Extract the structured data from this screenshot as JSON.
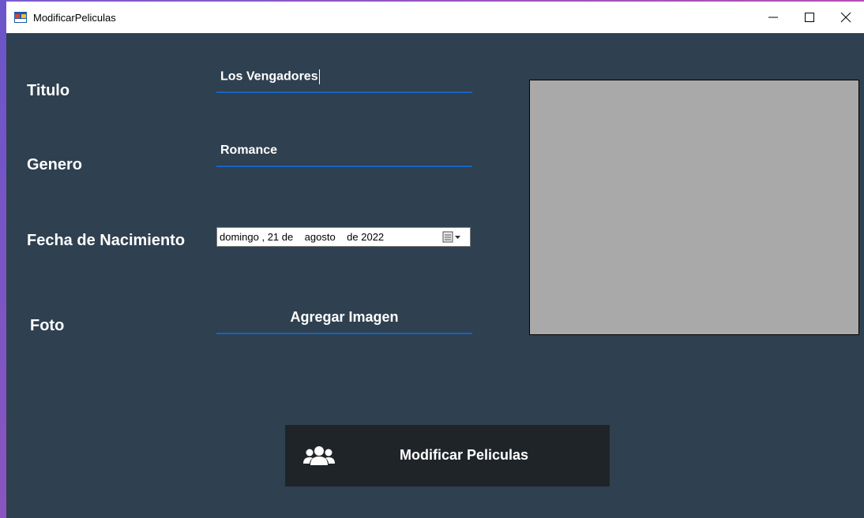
{
  "window": {
    "title": "ModificarPeliculas",
    "controls": [
      "minimize",
      "maximize",
      "close"
    ]
  },
  "form": {
    "titulo_label": "Titulo",
    "titulo_value": "Los Vengadores",
    "genero_label": "Genero",
    "genero_value": "Romance",
    "fecha_label": "Fecha de Nacimiento",
    "fecha_value": "domingo , 21 de    agosto    de 2022",
    "foto_label": "Foto",
    "agregar_imagen_label": "Agregar Imagen",
    "submit_label": "Modificar Peliculas"
  },
  "icons": {
    "app": "app-window-icon",
    "calendar": "calendar-dropdown-icon",
    "submit": "users-icon"
  },
  "colors": {
    "background": "#2f4050",
    "underline": "#1565c0",
    "button": "#1f2429",
    "picture": "#a9a9a9"
  }
}
